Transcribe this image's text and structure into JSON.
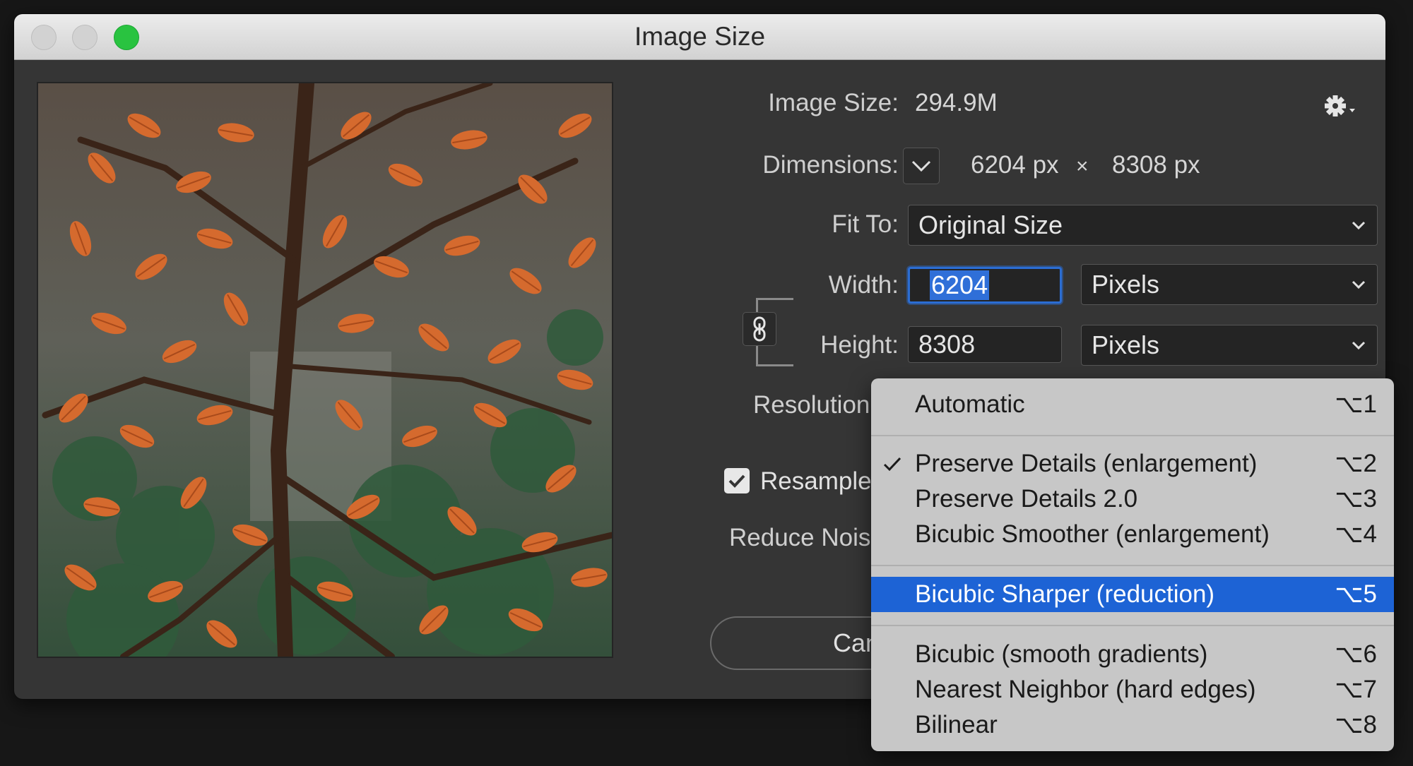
{
  "window": {
    "title": "Image Size"
  },
  "info": {
    "image_size_label": "Image Size:",
    "image_size_value": "294.9M",
    "dimensions_label": "Dimensions:",
    "width_px": "6204 px",
    "times": "×",
    "height_px": "8308 px"
  },
  "fit_to": {
    "label": "Fit To:",
    "value": "Original Size"
  },
  "width": {
    "label": "Width:",
    "value": "6204",
    "unit": "Pixels"
  },
  "height": {
    "label": "Height:",
    "value": "8308",
    "unit": "Pixels"
  },
  "resolution": {
    "label": "Resolution"
  },
  "resample": {
    "label": "Resample:",
    "checked": true
  },
  "reduce_noise": {
    "label": "Reduce Noise"
  },
  "cancel": {
    "label": "Canc"
  },
  "menu": {
    "items": [
      {
        "label": "Automatic",
        "shortcut": "⌥1"
      },
      {
        "label": "Preserve Details (enlargement)",
        "shortcut": "⌥2",
        "checked": true
      },
      {
        "label": "Preserve Details 2.0",
        "shortcut": "⌥3"
      },
      {
        "label": "Bicubic Smoother (enlargement)",
        "shortcut": "⌥4"
      },
      {
        "label": "Bicubic Sharper (reduction)",
        "shortcut": "⌥5",
        "highlighted": true
      },
      {
        "label": "Bicubic (smooth gradients)",
        "shortcut": "⌥6"
      },
      {
        "label": "Nearest Neighbor (hard edges)",
        "shortcut": "⌥7"
      },
      {
        "label": "Bilinear",
        "shortcut": "⌥8"
      }
    ]
  },
  "colors": {
    "highlight": "#1d63d5",
    "accent_focus": "#2b6dd3",
    "zoom": "#29c340"
  }
}
